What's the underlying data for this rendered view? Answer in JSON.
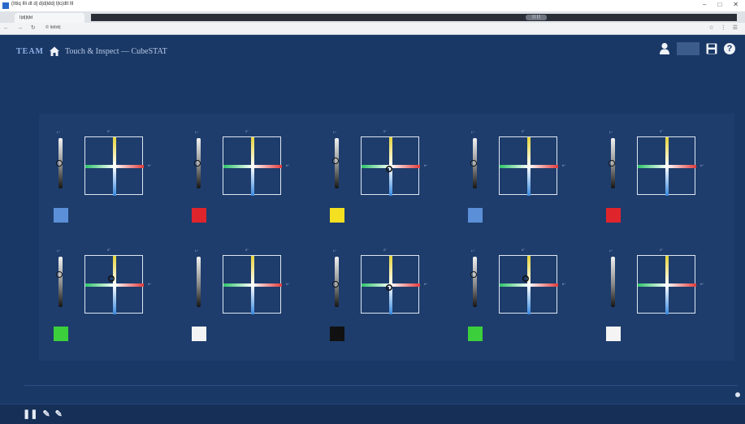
{
  "window": {
    "title_text": "(Ittiq Illi dt d| d|d|ldd| l|lc|dtt ltl",
    "buttons": [
      "–",
      "□",
      "✕"
    ]
  },
  "tab": {
    "label": "I|d||t|ld"
  },
  "tab_strip": {
    "pill": "| | | |"
  },
  "address": {
    "nav_icons": "← → ↻",
    "url": "© ltdldt|",
    "right_icons": "☆ ⋮ ☰"
  },
  "header": {
    "brand": "TEAM",
    "title": "Touch & Inspect — CubeSTAT"
  },
  "colors": {
    "background": "#1a3866",
    "panel": "#1e3d6c",
    "red_axis": "#e03a3a",
    "green_axis": "#2ec46a",
    "yellow_axis": "#e6d43a",
    "blue_axis": "#3a8ae0"
  },
  "axes": {
    "plot_top_label": "0°",
    "plot_right_label": "b*",
    "slider_top_label": "L*",
    "ticks_left": [
      "",
      "",
      "",
      "",
      "",
      ""
    ],
    "ticks_bottom": [
      "",
      "",
      "",
      "",
      "",
      ""
    ]
  },
  "cells": [
    {
      "swatch": "#5b90d8",
      "caption": "",
      "knob": 0.5,
      "marker": null,
      "values": [
        [
          "",
          "",
          "",
          ""
        ],
        [
          "",
          "",
          "",
          ""
        ],
        [
          "",
          "",
          "",
          ""
        ]
      ]
    },
    {
      "swatch": "#e0242c",
      "caption": "",
      "knob": 0.5,
      "marker": null,
      "values": [
        [
          "",
          "",
          "",
          ""
        ],
        [
          "",
          "",
          "",
          ""
        ],
        [
          "",
          "",
          "",
          ""
        ]
      ]
    },
    {
      "swatch": "#f4e020",
      "caption": "",
      "knob": 0.45,
      "marker": "center",
      "values": [
        [
          "",
          "",
          "",
          ""
        ],
        [
          "",
          "",
          "",
          ""
        ],
        [
          "",
          "",
          "",
          ""
        ]
      ]
    },
    {
      "swatch": "#5b90d8",
      "caption": "",
      "knob": 0.5,
      "marker": null,
      "values": [
        [
          "",
          "",
          "",
          ""
        ],
        [
          "",
          "",
          "",
          ""
        ],
        [
          "",
          "",
          "",
          ""
        ]
      ]
    },
    {
      "swatch": "#e0242c",
      "caption": "",
      "knob": 0.5,
      "marker": null,
      "values": [
        [
          "",
          "",
          "",
          ""
        ],
        [
          "",
          "",
          "",
          ""
        ],
        [
          "",
          "",
          "",
          ""
        ]
      ]
    },
    {
      "swatch": "#3ccf3c",
      "caption": "",
      "knob": 0.35,
      "marker": "upper",
      "values": [
        [
          "",
          "",
          "",
          ""
        ],
        [
          "",
          "",
          "",
          ""
        ],
        [
          "",
          "",
          "",
          ""
        ]
      ]
    },
    {
      "swatch": "#f4f4f4",
      "caption": "",
      "knob": null,
      "marker": null,
      "values": [
        [
          "",
          "",
          "",
          ""
        ],
        [
          "",
          "",
          "",
          ""
        ],
        [
          "",
          "",
          "",
          ""
        ]
      ]
    },
    {
      "swatch": "#111111",
      "caption": "",
      "knob": 0.55,
      "marker": "center",
      "values": [
        [
          "",
          "",
          "",
          ""
        ],
        [
          "",
          "",
          "",
          ""
        ],
        [
          "",
          "",
          "",
          ""
        ]
      ]
    },
    {
      "swatch": "#3ccf3c",
      "caption": "",
      "knob": 0.35,
      "marker": "upper",
      "values": [
        [
          "",
          "",
          "",
          ""
        ],
        [
          "",
          "",
          "",
          ""
        ],
        [
          "",
          "",
          "",
          ""
        ]
      ]
    },
    {
      "swatch": "#f4f4f4",
      "caption": "",
      "knob": null,
      "marker": null,
      "values": [
        [
          "",
          "",
          "",
          ""
        ],
        [
          "",
          "",
          "",
          ""
        ],
        [
          "",
          "",
          "",
          ""
        ]
      ]
    }
  ],
  "bottom": {
    "icons": [
      "❚❚",
      "✎",
      "✎"
    ],
    "labels": [
      "",
      "",
      ""
    ]
  }
}
